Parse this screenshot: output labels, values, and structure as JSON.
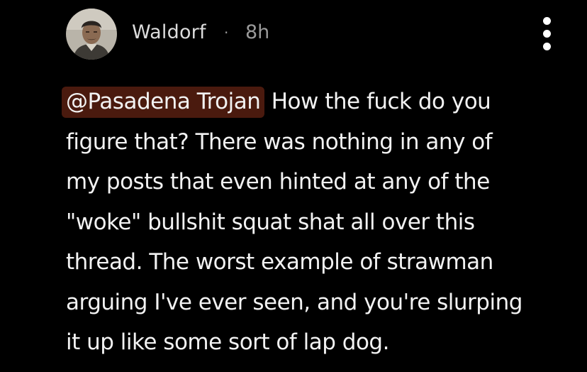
{
  "comment": {
    "author": "Waldorf",
    "separator": "·",
    "timestamp": "8h",
    "avatar_icon": "user-avatar-photo",
    "menu_icon": "more-vertical-icon",
    "mention": "@Pasadena Trojan",
    "lines": [
      "How the fuck do you",
      "figure that?  There was nothing in any of",
      "my posts that even hinted at any of the",
      "\"woke\" bullshit squat shat all over this",
      "thread.  The worst example of strawman",
      "arguing I've ever seen, and you're slurping",
      "it up like some sort of lap dog."
    ],
    "colors": {
      "background": "#000000",
      "mention_bg": "#4a1a0e",
      "text": "#f2f2f2",
      "muted": "#9a9a9a"
    }
  }
}
